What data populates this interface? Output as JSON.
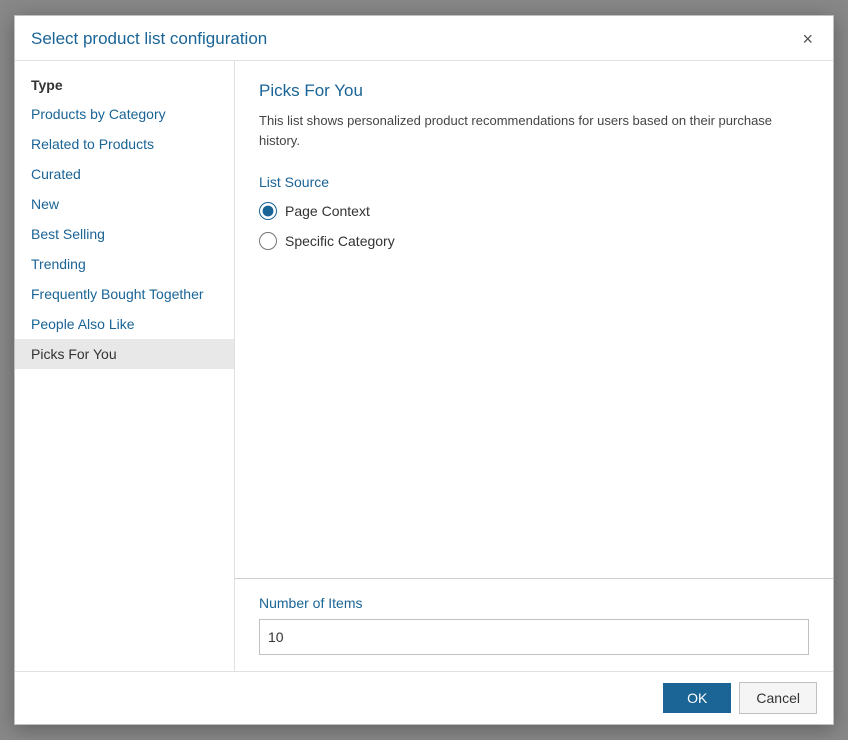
{
  "dialog": {
    "title": "Select product list configuration",
    "close_label": "×"
  },
  "sidebar": {
    "section_label": "Type",
    "items": [
      {
        "id": "products-by-category",
        "label": "Products by Category",
        "active": false
      },
      {
        "id": "related-to-products",
        "label": "Related to Products",
        "active": false
      },
      {
        "id": "curated",
        "label": "Curated",
        "active": false
      },
      {
        "id": "new",
        "label": "New",
        "active": false
      },
      {
        "id": "best-selling",
        "label": "Best Selling",
        "active": false
      },
      {
        "id": "trending",
        "label": "Trending",
        "active": false
      },
      {
        "id": "frequently-bought-together",
        "label": "Frequently Bought Together",
        "active": false
      },
      {
        "id": "people-also-like",
        "label": "People Also Like",
        "active": false
      },
      {
        "id": "picks-for-you",
        "label": "Picks For You",
        "active": true
      }
    ]
  },
  "main": {
    "content_title": "Picks For You",
    "content_description": "This list shows personalized product recommendations for users based on their purchase history.",
    "list_source_label": "List Source",
    "radio_options": [
      {
        "id": "page-context",
        "label": "Page Context",
        "checked": true
      },
      {
        "id": "specific-category",
        "label": "Specific Category",
        "checked": false
      }
    ],
    "number_of_items_label": "Number of Items",
    "number_of_items_value": "10"
  },
  "footer": {
    "ok_label": "OK",
    "cancel_label": "Cancel"
  }
}
